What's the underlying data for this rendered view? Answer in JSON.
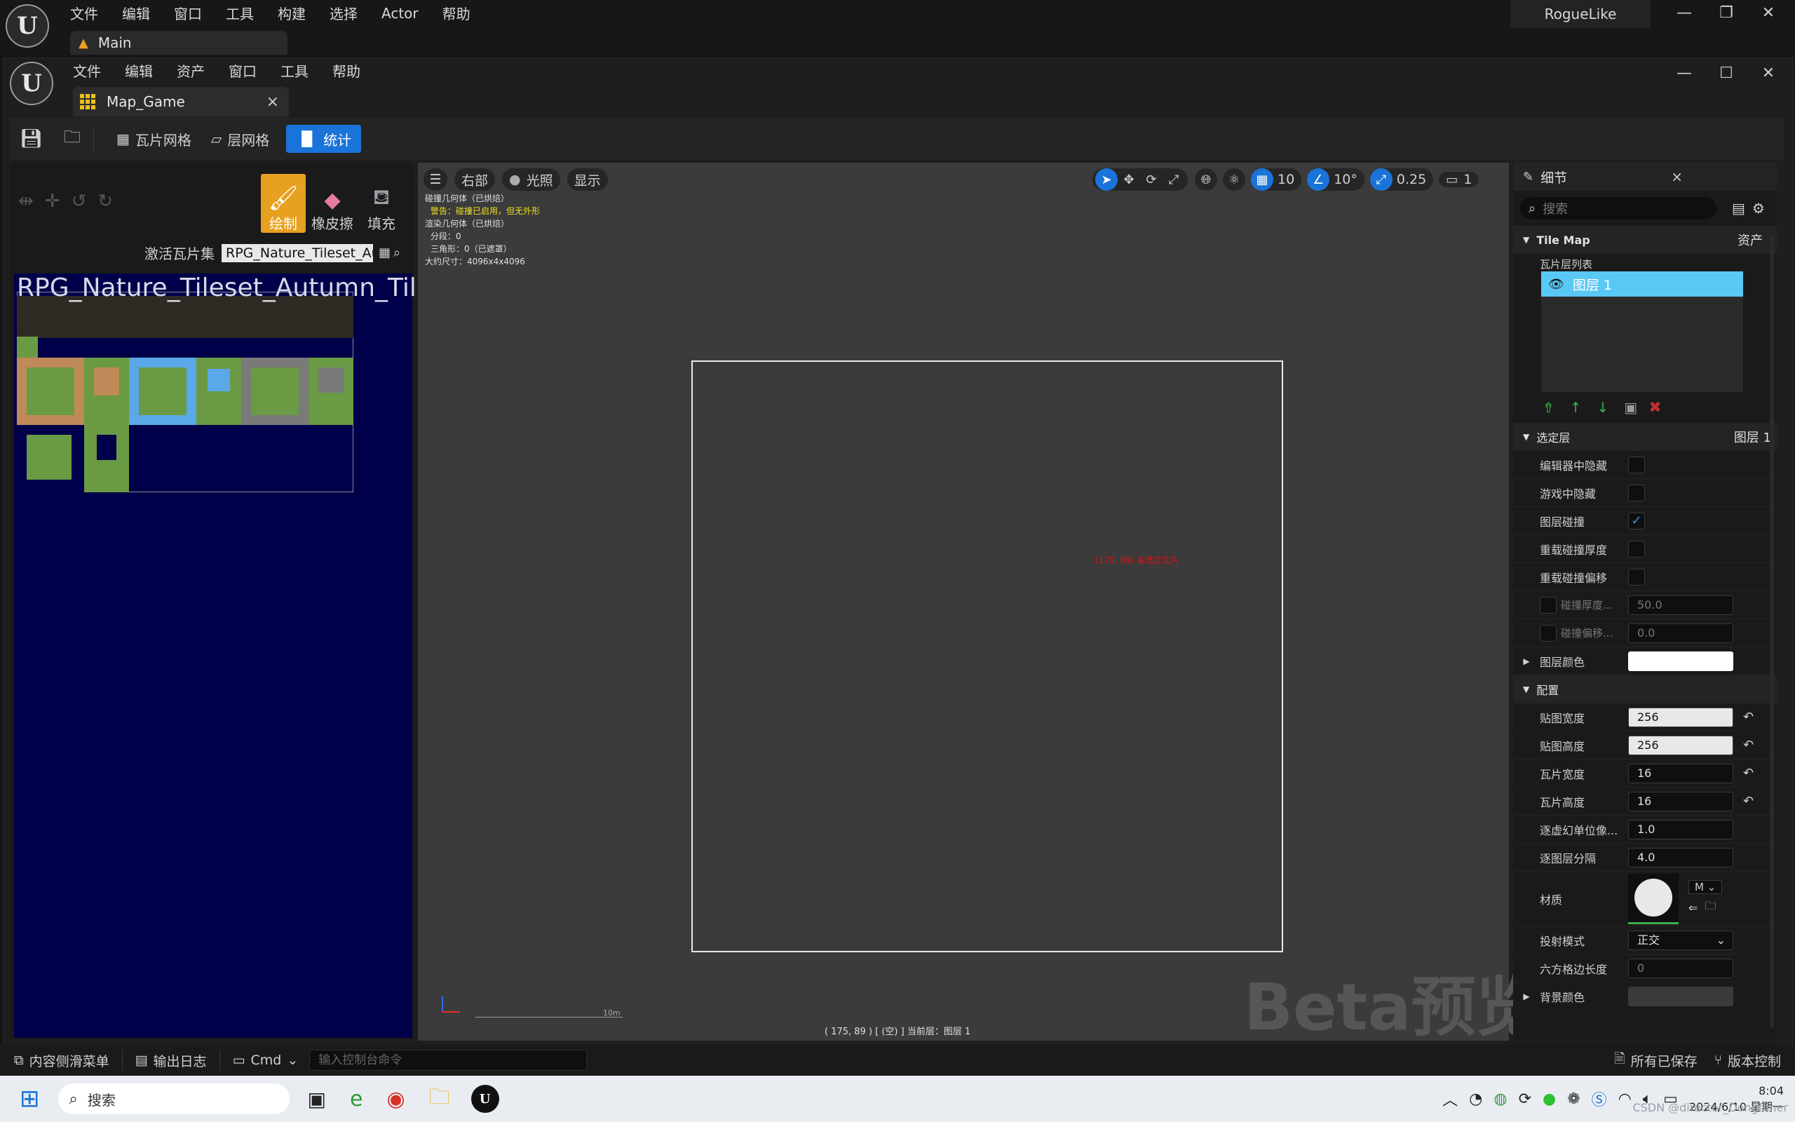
{
  "outer": {
    "menu": [
      "文件",
      "编辑",
      "窗口",
      "工具",
      "构建",
      "选择",
      "Actor",
      "帮助"
    ],
    "tab_label": "Main",
    "project_name": "RogueLike"
  },
  "inner": {
    "menu": [
      "文件",
      "编辑",
      "资产",
      "窗口",
      "工具",
      "帮助"
    ],
    "tab_label": "Map_Game",
    "tab_close": "×"
  },
  "toolbar": {
    "tile_grid": "瓦片网格",
    "layer_grid": "层网格",
    "stats": "统计"
  },
  "palette": {
    "tools": [
      "绘制",
      "橡皮擦",
      "填充"
    ],
    "active_tileset_label": "激活瓦片集",
    "active_tileset_value": "RPG_Nature_Tileset_Au",
    "tileset_title": "RPG_Nature_Tileset_Autumn_TileS"
  },
  "viewport": {
    "view_mode": "右部",
    "lighting": "光照",
    "show": "显示",
    "grid_snap": "10",
    "rotation_snap": "10°",
    "scale_snap": "0.25",
    "camera_speed": "1",
    "stats": [
      "碰撞几何体（已烘焙）",
      "警告：碰撞已启用，但无外形",
      "渲染几何体（已烘焙）",
      "分段：0",
      "三角形：0（已遮罩）",
      "大约尺寸：4096x4x4096"
    ],
    "cursor_note": "(175, 89) 未选定瓦片",
    "scale_label": "10m",
    "status": "( 175, 89 ) [ (空) ]  当前层：图层 1",
    "watermark": "Beta预览"
  },
  "details": {
    "tab_label": "细节",
    "search_placeholder": "搜索",
    "tile_map_section": "Tile Map",
    "asset_label": "资产",
    "layer_list_label": "瓦片层列表",
    "layer_name": "图层 1",
    "selected_layer_section": "选定层",
    "selected_layer_value": "图层 1",
    "checkbox_rows": [
      {
        "label": "编辑器中隐藏",
        "checked": false
      },
      {
        "label": "游戏中隐藏",
        "checked": false
      },
      {
        "label": "图层碰撞",
        "checked": true
      },
      {
        "label": "重载碰撞厚度",
        "checked": false
      },
      {
        "label": "重载碰撞偏移",
        "checked": false
      }
    ],
    "collision_thickness_label": "碰撞厚度...",
    "collision_thickness": "50.0",
    "collision_offset_label": "碰撞偏移...",
    "collision_offset": "0.0",
    "layer_color_label": "图层颜色",
    "config_section": "配置",
    "config_rows": [
      {
        "label": "贴图宽度",
        "value": "256",
        "reset": true
      },
      {
        "label": "贴图高度",
        "value": "256",
        "reset": true
      },
      {
        "label": "瓦片宽度",
        "value": "16",
        "reset": true
      },
      {
        "label": "瓦片高度",
        "value": "16",
        "reset": true
      },
      {
        "label": "逐虚幻单位像...",
        "value": "1.0",
        "reset": false
      },
      {
        "label": "逐图层分隔",
        "value": "4.0",
        "reset": false
      }
    ],
    "material_label": "材质",
    "material_badge": "M",
    "projection_label": "投射模式",
    "projection_value": "正交",
    "hex_label": "六方格边长度",
    "hex_value": "0",
    "bg_color_label": "背景颜色"
  },
  "statusbar": {
    "content_drawer": "内容侧滑菜单",
    "output_log": "输出日志",
    "cmd": "Cmd",
    "console_placeholder": "输入控制台命令",
    "all_saved": "所有已保存",
    "source_control": "版本控制"
  },
  "taskbar": {
    "search": "搜索",
    "time": "8:04",
    "date": "2024/6/10 星期一",
    "watermark": "CSDN @director_Dongfhner"
  },
  "colors": {
    "accent": "#1a73d8",
    "tool_active": "#e8a020",
    "layer_selected": "#5ac8f5",
    "tileset_bg": "#00004a"
  }
}
